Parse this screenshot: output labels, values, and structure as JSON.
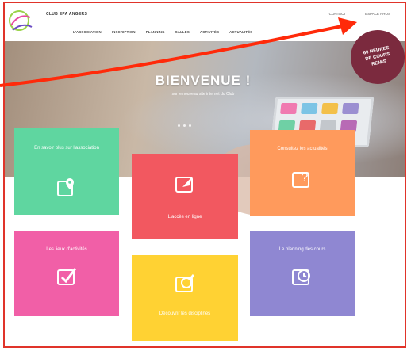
{
  "header": {
    "brand": "CLUB EPA ANGERS",
    "links": {
      "contact": "CONTACT",
      "space": "ESPACE PROS"
    }
  },
  "nav": [
    "L'ASSOCIATION",
    "INSCRIPTION",
    "PLANNING",
    "SALLES",
    "ACTIVITÉS",
    "ACTUALITÉS"
  ],
  "hero": {
    "title": "BIENVENUE !",
    "subtitle": "sur le nouveau site internet du Club",
    "badge": [
      "60 HEURES",
      "DE COURS",
      "REMIS"
    ]
  },
  "tiles": {
    "association": {
      "label": "En savoir plus sur l'association",
      "color": "#5fd6a0",
      "icon": "map-pin-icon"
    },
    "online": {
      "label": "L'accès en ligne",
      "color": "#f25860",
      "icon": "cursor-arrow-icon"
    },
    "news": {
      "label": "Consultez les actualités",
      "color": "#ff9a5c",
      "icon": "question-icon"
    },
    "places": {
      "label": "Les lieux d'activités",
      "color": "#f15fa7",
      "icon": "checkbox-icon"
    },
    "disciplines": {
      "label": "Découvrir les disciplines",
      "color": "#ffd233",
      "icon": "magnifier-icon"
    },
    "planning": {
      "label": "Le planning des cours",
      "color": "#8f87d2",
      "icon": "clock-icon"
    }
  },
  "annotation": {
    "arrow_color": "#ff2a0a"
  }
}
